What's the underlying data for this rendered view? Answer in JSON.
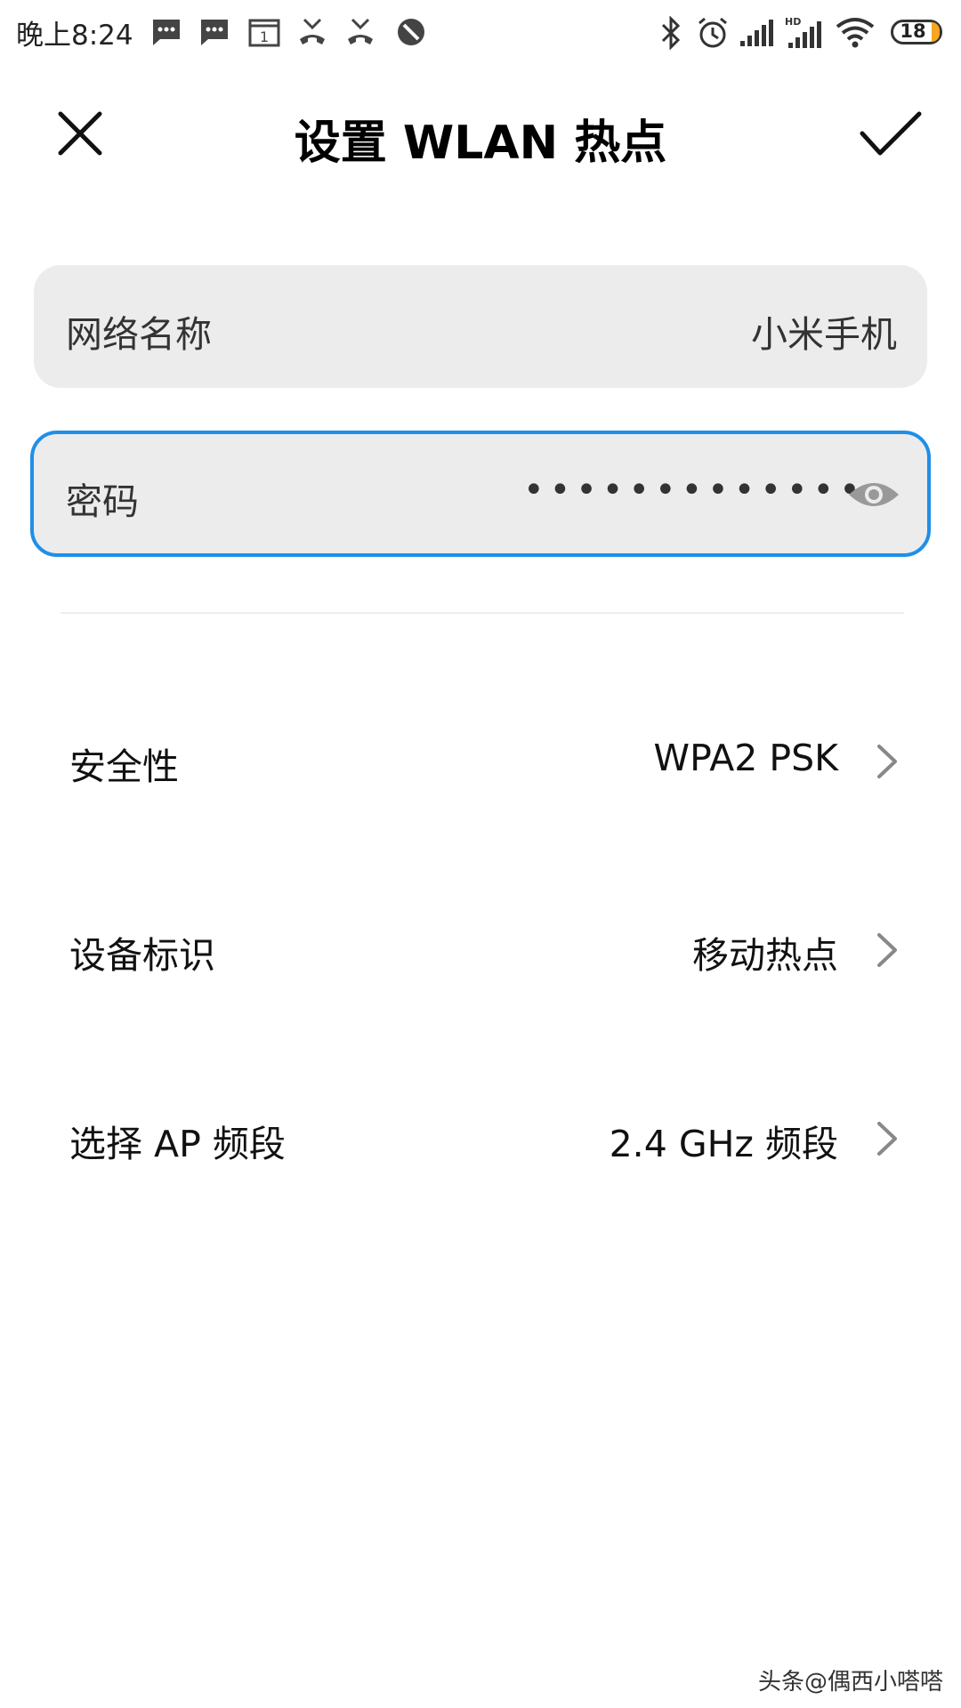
{
  "status_bar": {
    "time": "晚上8:24",
    "battery": "18",
    "battery_level": 0.18,
    "network_label": "HD",
    "icons": [
      "message-icon",
      "message-icon",
      "calendar-icon",
      "missed-call-icon",
      "missed-call-icon",
      "block-icon",
      "bluetooth-icon",
      "alarm-icon",
      "signal-icon",
      "signal-hd-icon",
      "wifi-icon",
      "battery-icon"
    ],
    "calendar_day": "1"
  },
  "header": {
    "title": "设置 WLAN 热点",
    "close_icon": "close-icon",
    "confirm_icon": "check-icon"
  },
  "fields": {
    "network_name_label": "网络名称",
    "network_name_value": "小米手机",
    "password_label": "密码",
    "password_mask": "•••••••••••••",
    "password_icon": "eye-icon",
    "focus_color": "#1f8fe8"
  },
  "settings": [
    {
      "label": "安全性",
      "value": "WPA2 PSK"
    },
    {
      "label": "设备标识",
      "value": "移动热点"
    },
    {
      "label": "选择 AP 频段",
      "value": "2.4 GHz 频段"
    }
  ],
  "watermark": "头条@偶西小嗒嗒"
}
